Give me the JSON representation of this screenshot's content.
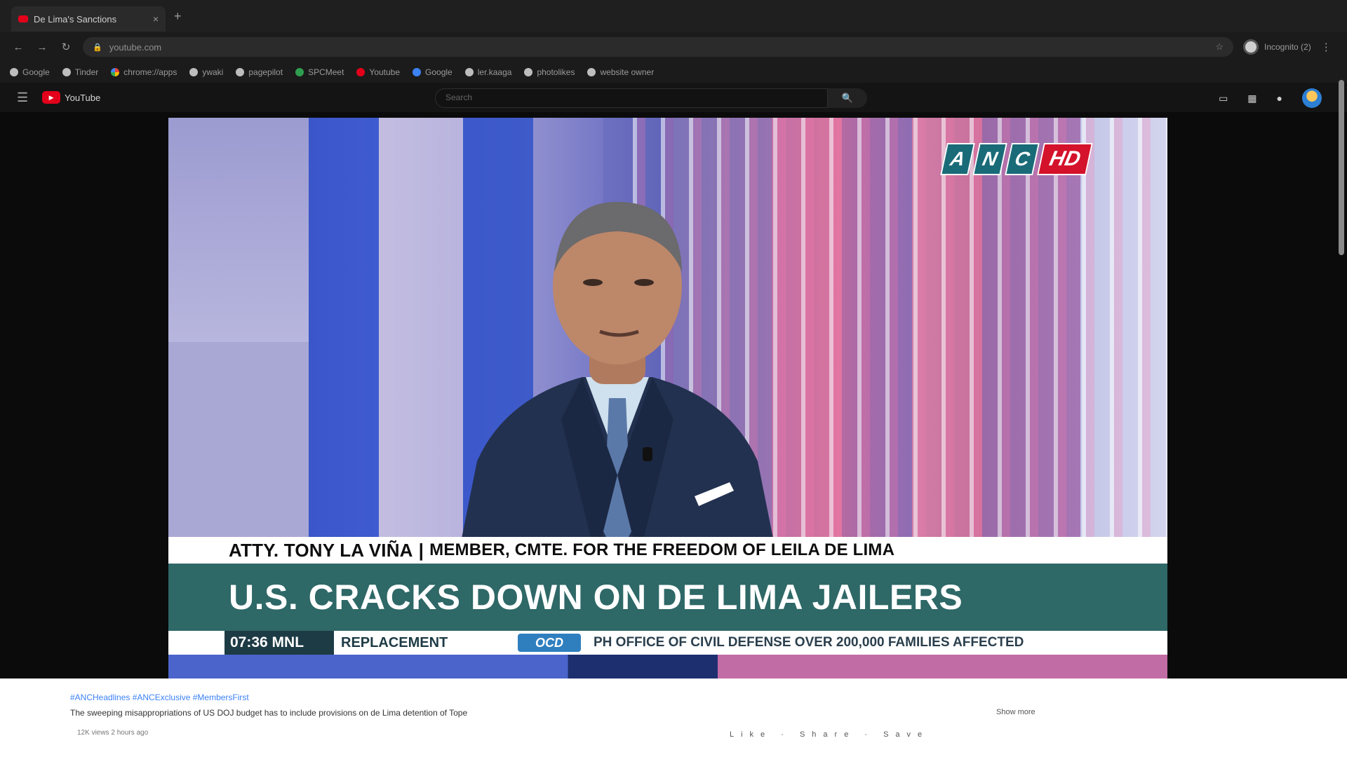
{
  "browser": {
    "tab_title": "De Lima's Sanctions",
    "tab_close": "×",
    "new_tab": "+",
    "url": "youtube.com",
    "profile_label": "Incognito (2)",
    "bookmarks": [
      {
        "label": "Google",
        "icon": "google-icon"
      },
      {
        "label": "Tinder",
        "icon": "globe-icon"
      },
      {
        "label": "chrome://apps",
        "icon": "chrome-icon"
      },
      {
        "label": "ywaki",
        "icon": "globe-icon"
      },
      {
        "label": "pagepilot",
        "icon": "globe-icon"
      },
      {
        "label": "SPCMeet",
        "icon": "globe-icon"
      },
      {
        "label": "Youtube",
        "icon": "youtube-icon"
      },
      {
        "label": "Google",
        "icon": "globe-icon"
      },
      {
        "label": "ler.kaaga",
        "icon": "globe-icon"
      },
      {
        "label": "photolikes",
        "icon": "globe-icon"
      },
      {
        "label": "website owner",
        "icon": "globe-icon"
      }
    ]
  },
  "youtube": {
    "logo_text": "YouTube",
    "search_placeholder": "Search",
    "search_icon": "🔍"
  },
  "video": {
    "network_logo": [
      "A",
      "N",
      "C"
    ],
    "network_hd": "HD",
    "guest_name": "ATTY. TONY LA VIÑA",
    "separator": "|",
    "guest_role": "MEMBER, CMTE. FOR THE FREEDOM OF LEILA DE LIMA",
    "headline": "U.S. CRACKS DOWN ON DE LIMA JAILERS",
    "ticker_time": "07:36 MNL",
    "ticker_text_1": "REPLACEMENT",
    "ticker_badge": "OCD",
    "ticker_text_2": "PH OFFICE OF CIVIL DEFENSE OVER 200,000 FAMILIES AFFECTED"
  },
  "below": {
    "hashtags": "#ANCHeadlines #ANCExclusive #MembersFirst",
    "description": "The sweeping misappropriations of US DOJ budget has to include provisions on de Lima detention of Tope",
    "show_more": "Show more",
    "meta": "12K views 2 hours ago",
    "actions": "Like · Share · Save"
  }
}
